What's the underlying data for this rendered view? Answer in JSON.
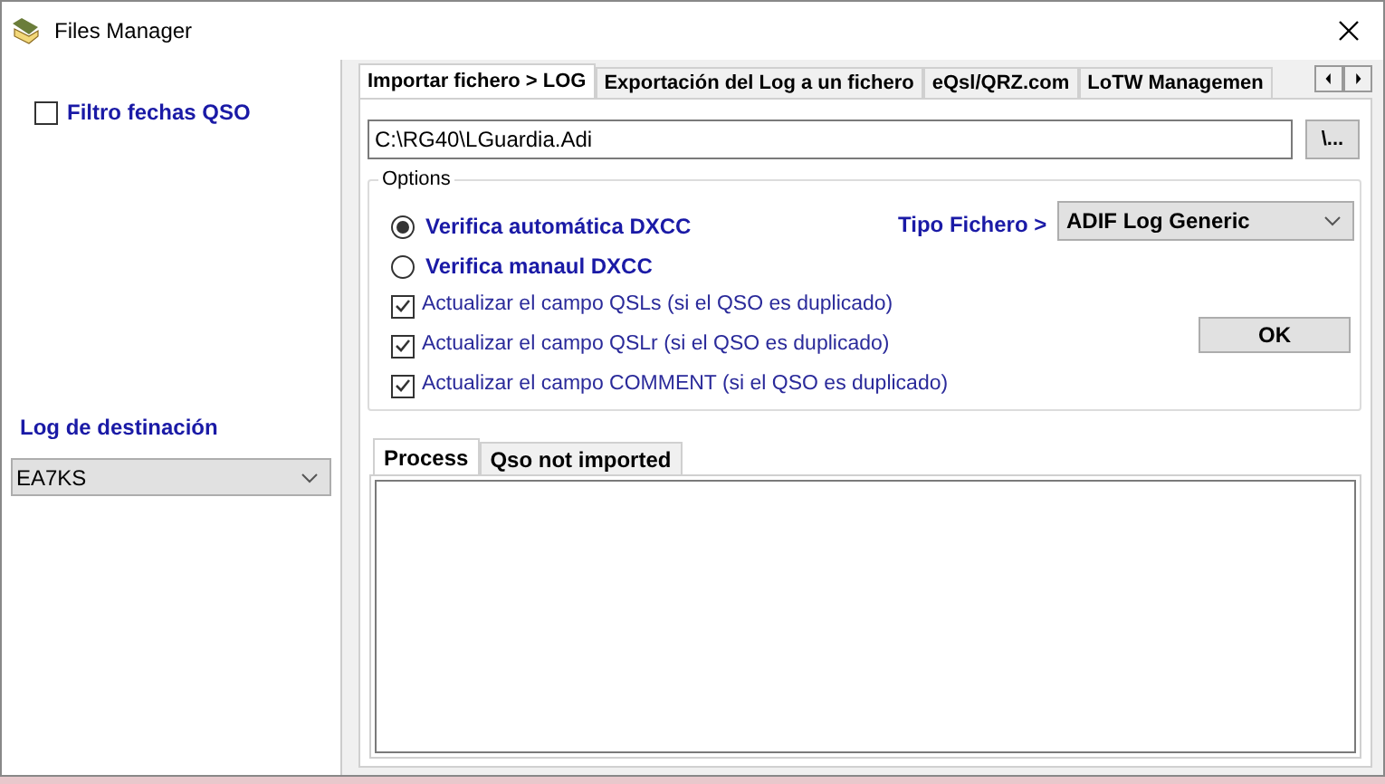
{
  "window": {
    "title": "Files Manager"
  },
  "left": {
    "filter": {
      "label": "Filtro fechas QSO",
      "checked": false
    },
    "destination_label": "Log de destinación",
    "destination_value": "EA7KS"
  },
  "tabs": [
    {
      "label": "Importar fichero > LOG",
      "selected": true
    },
    {
      "label": "Exportación del Log a un fichero",
      "selected": false
    },
    {
      "label": "eQsl/QRZ.com",
      "selected": false
    },
    {
      "label": "LoTW Managemen",
      "selected": false
    }
  ],
  "path": {
    "value": "C:\\RG40\\LGuardia.Adi",
    "browse": "\\..."
  },
  "options": {
    "title": "Options",
    "radios": [
      {
        "label": "Verifica automática DXCC",
        "selected": true
      },
      {
        "label": "Verifica manaul DXCC",
        "selected": false
      }
    ],
    "file_type_label": "Tipo Fichero >",
    "file_type_value": "ADIF Log Generic",
    "checks": [
      {
        "label": "Actualizar el campo QSLs (si el QSO es duplicado)",
        "checked": true
      },
      {
        "label": "Actualizar el campo QSLr (si el QSO es duplicado)",
        "checked": true
      },
      {
        "label": "Actualizar el campo COMMENT (si el QSO es duplicado)",
        "checked": true
      }
    ],
    "ok": "OK"
  },
  "process_tabs": [
    {
      "label": "Process",
      "selected": true
    },
    {
      "label": "Qso not imported",
      "selected": false
    }
  ]
}
